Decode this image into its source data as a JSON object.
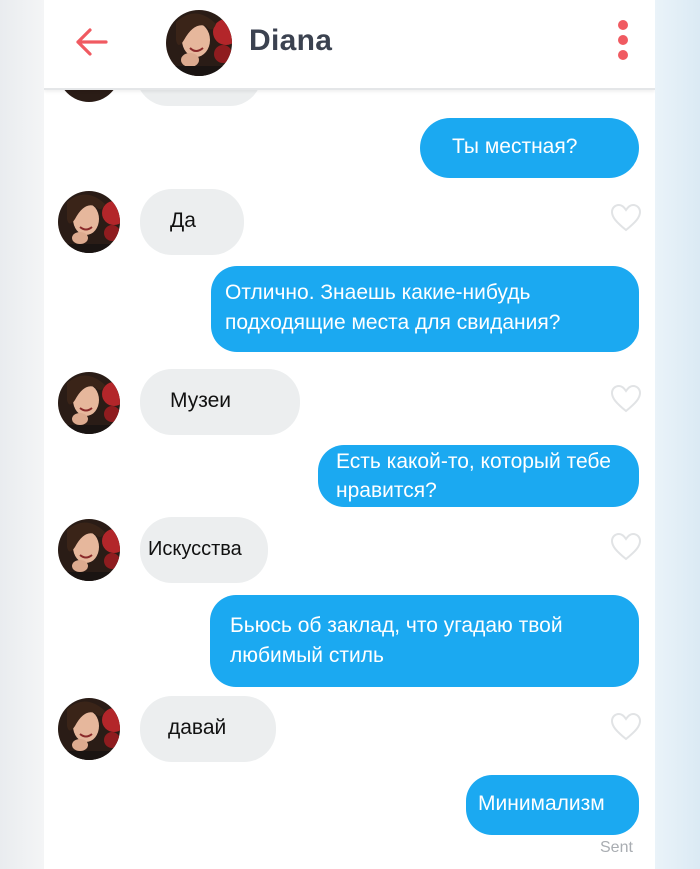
{
  "header": {
    "title": "Diana",
    "back_icon": "arrow-left-icon",
    "menu_icon": "vertical-dots-icon",
    "accent": "#f05a61"
  },
  "colors": {
    "outgoing_bubble": "#1ba9f1",
    "incoming_bubble": "#eceeef"
  },
  "messages": [
    {
      "direction": "out",
      "text": "Ты местная?"
    },
    {
      "direction": "in",
      "text": "Да"
    },
    {
      "direction": "out",
      "text": "Отлично. Знаешь какие-нибудь подходящие места для свидания?"
    },
    {
      "direction": "in",
      "text": "Музеи"
    },
    {
      "direction": "out",
      "text": "Есть какой-то, который тебе нравится?"
    },
    {
      "direction": "in",
      "text": "Искусства"
    },
    {
      "direction": "out",
      "text": "Бьюсь об заклад, что угадаю твой любимый стиль"
    },
    {
      "direction": "in",
      "text": "давай"
    },
    {
      "direction": "out",
      "text": "Минимализм"
    }
  ],
  "status": "Sent"
}
